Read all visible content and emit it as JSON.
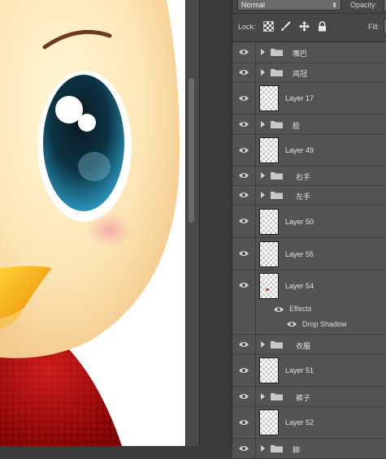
{
  "panel": {
    "blend_mode": "Normal",
    "opacity_label": "Opacity:",
    "lock_label": "Lock:",
    "fill_label": "Fill:"
  },
  "layers": [
    {
      "type": "group",
      "name": "嘴巴"
    },
    {
      "type": "group",
      "name": "鸡冠"
    },
    {
      "type": "layer",
      "name": "Layer 17"
    },
    {
      "type": "group",
      "name": "脸"
    },
    {
      "type": "layer",
      "name": "Layer 49"
    },
    {
      "type": "group",
      "name": "右手"
    },
    {
      "type": "group",
      "name": "左手"
    },
    {
      "type": "layer",
      "name": "Layer 50"
    },
    {
      "type": "layer",
      "name": "Layer 55"
    },
    {
      "type": "layer",
      "name": "Layer 54",
      "effects_label": "Effects",
      "effect": "Drop Shadow"
    },
    {
      "type": "group",
      "name": "衣服"
    },
    {
      "type": "layer",
      "name": "Layer 51"
    },
    {
      "type": "group",
      "name": "裤子"
    },
    {
      "type": "layer",
      "name": "Layer 52"
    },
    {
      "type": "group",
      "name": "脚"
    }
  ],
  "icons": {
    "visibility": "eye-icon",
    "expand": "disclosure-triangle-icon",
    "group": "folder-icon",
    "lock_transparent": "checker-lock-icon",
    "lock_image": "brush-icon",
    "lock_position": "move-icon",
    "lock_all": "padlock-icon"
  },
  "colors": {
    "panel_bg": "#535353",
    "canvas_bg": "#ffffff",
    "eye_iris": "#1f6f8a",
    "cheek": "#f3a3a8",
    "beak": "#f3a300",
    "clothes": "#b00000"
  }
}
